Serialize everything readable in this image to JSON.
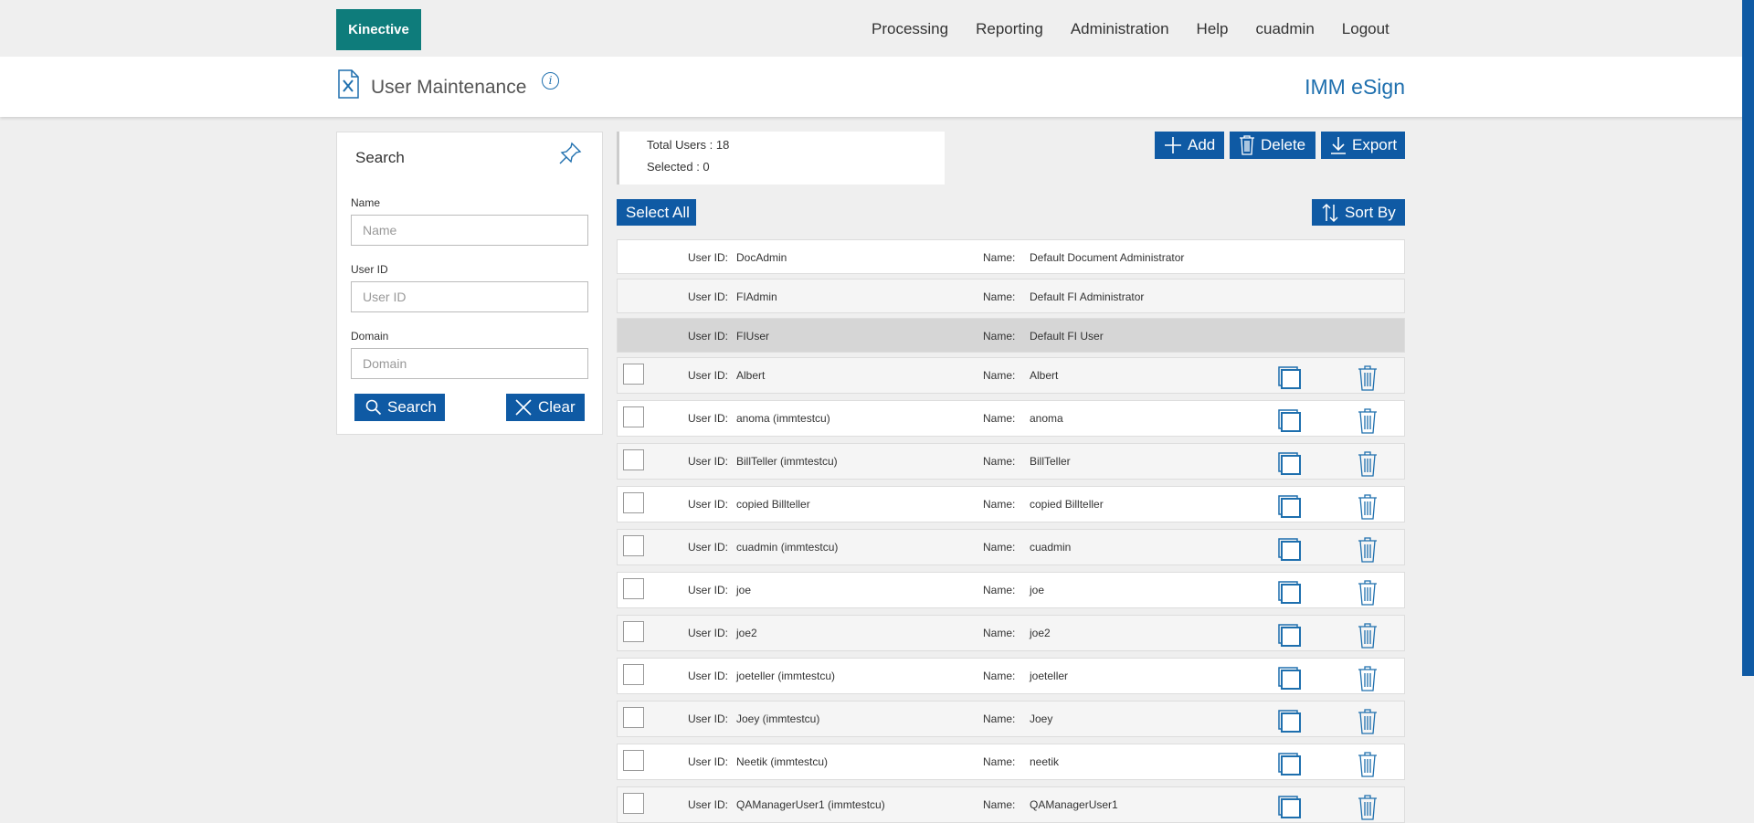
{
  "topbar": {
    "logo": "Kinective",
    "nav": [
      "Processing",
      "Reporting",
      "Administration",
      "Help",
      "cuadmin",
      "Logout"
    ]
  },
  "header": {
    "title": "User Maintenance",
    "info": "i",
    "brand": "IMM eSign"
  },
  "search": {
    "title": "Search",
    "name_label": "Name",
    "name_placeholder": "Name",
    "userid_label": "User ID",
    "userid_placeholder": "User ID",
    "domain_label": "Domain",
    "domain_placeholder": "Domain",
    "search_button": "Search",
    "clear_button": "Clear"
  },
  "summary": {
    "total": "Total Users : 18",
    "selected": "Selected : 0"
  },
  "toolbar": {
    "add": "Add",
    "delete": "Delete",
    "export": "Export",
    "select_all": "Select All",
    "sort_by": "Sort By"
  },
  "labels": {
    "user_id": "User ID:",
    "name": "Name:"
  },
  "users": [
    {
      "id": "DocAdmin",
      "name": "Default Document Administrator",
      "editable": false
    },
    {
      "id": "FIAdmin",
      "name": "Default FI Administrator",
      "editable": false
    },
    {
      "id": "FIUser",
      "name": "Default FI User",
      "editable": false,
      "selected": true
    },
    {
      "id": "Albert",
      "name": "Albert",
      "editable": true
    },
    {
      "id": "anoma (immtestcu)",
      "name": "anoma",
      "editable": true
    },
    {
      "id": "BillTeller (immtestcu)",
      "name": "BillTeller",
      "editable": true
    },
    {
      "id": "copied Billteller",
      "name": "copied Billteller",
      "editable": true
    },
    {
      "id": "cuadmin (immtestcu)",
      "name": "cuadmin",
      "editable": true
    },
    {
      "id": "joe",
      "name": "joe",
      "editable": true
    },
    {
      "id": "joe2",
      "name": "joe2",
      "editable": true
    },
    {
      "id": "joeteller (immtestcu)",
      "name": "joeteller",
      "editable": true
    },
    {
      "id": "Joey (immtestcu)",
      "name": "Joey",
      "editable": true
    },
    {
      "id": "Neetik (immtestcu)",
      "name": "neetik",
      "editable": true
    },
    {
      "id": "QAManagerUser1 (immtestcu)",
      "name": "QAManagerUser1",
      "editable": true
    }
  ],
  "colors": {
    "primary": "#0f5aa4",
    "brand": "#1e6fae",
    "logo_bg": "#0e7c7b"
  }
}
